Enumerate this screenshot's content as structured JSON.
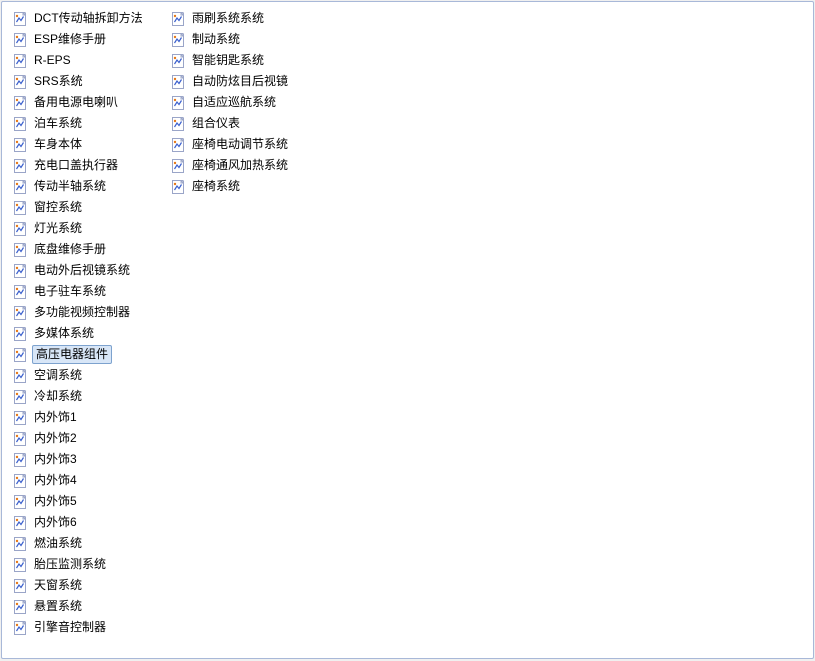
{
  "panel": {
    "items": [
      {
        "label": "DCT传动轴拆卸方法",
        "selected": false
      },
      {
        "label": "ESP维修手册",
        "selected": false
      },
      {
        "label": "R-EPS",
        "selected": false
      },
      {
        "label": "SRS系统",
        "selected": false
      },
      {
        "label": "备用电源电喇叭",
        "selected": false
      },
      {
        "label": "泊车系统",
        "selected": false
      },
      {
        "label": "车身本体",
        "selected": false
      },
      {
        "label": "充电口盖执行器",
        "selected": false
      },
      {
        "label": "传动半轴系统",
        "selected": false
      },
      {
        "label": "窗控系统",
        "selected": false
      },
      {
        "label": "灯光系统",
        "selected": false
      },
      {
        "label": "底盘维修手册",
        "selected": false
      },
      {
        "label": "电动外后视镜系统",
        "selected": false
      },
      {
        "label": "电子驻车系统",
        "selected": false
      },
      {
        "label": "多功能视频控制器",
        "selected": false
      },
      {
        "label": "多媒体系统",
        "selected": false
      },
      {
        "label": "高压电器组件",
        "selected": true
      },
      {
        "label": "空调系统",
        "selected": false
      },
      {
        "label": "冷却系统",
        "selected": false
      },
      {
        "label": "内外饰1",
        "selected": false
      },
      {
        "label": "内外饰2",
        "selected": false
      },
      {
        "label": "内外饰3",
        "selected": false
      },
      {
        "label": "内外饰4",
        "selected": false
      },
      {
        "label": "内外饰5",
        "selected": false
      },
      {
        "label": "内外饰6",
        "selected": false
      },
      {
        "label": "燃油系统",
        "selected": false
      },
      {
        "label": "胎压监测系统",
        "selected": false
      },
      {
        "label": "天窗系统",
        "selected": false
      },
      {
        "label": "悬置系统",
        "selected": false
      },
      {
        "label": "引擎音控制器",
        "selected": false
      },
      {
        "label": "雨刷系统系统",
        "selected": false
      },
      {
        "label": "制动系统",
        "selected": false
      },
      {
        "label": "智能钥匙系统",
        "selected": false
      },
      {
        "label": "自动防炫目后视镜",
        "selected": false
      },
      {
        "label": "自适应巡航系统",
        "selected": false
      },
      {
        "label": "组合仪表",
        "selected": false
      },
      {
        "label": "座椅电动调节系统",
        "selected": false
      },
      {
        "label": "座椅通风加热系统",
        "selected": false
      },
      {
        "label": "座椅系统",
        "selected": false
      }
    ]
  }
}
